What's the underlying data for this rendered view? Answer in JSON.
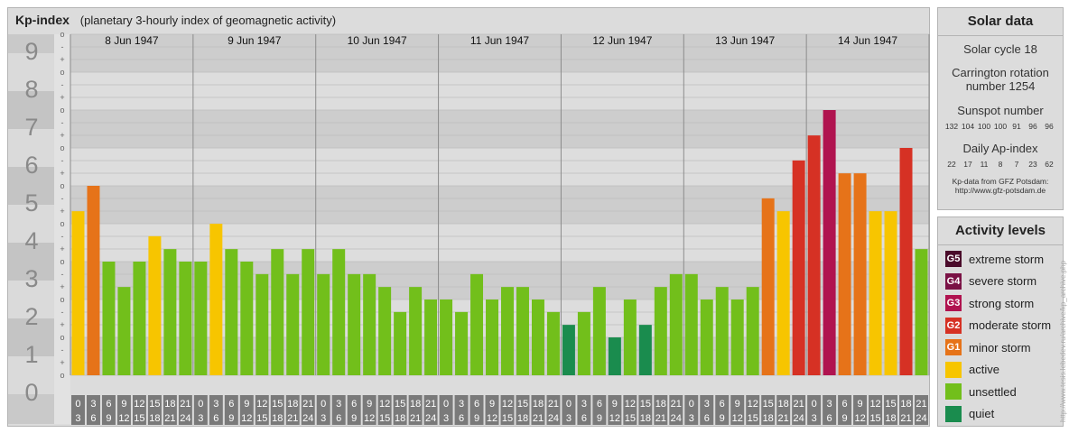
{
  "header": {
    "title": "Kp-index",
    "subtitle": "(planetary 3-hourly index of geomagnetic activity)"
  },
  "chart_data": {
    "type": "bar",
    "ylim": [
      0,
      9
    ],
    "y_ticks": [
      "0",
      "1",
      "2",
      "3",
      "4",
      "5",
      "6",
      "7",
      "8",
      "9"
    ],
    "third_marks": [
      "o",
      "+",
      "-"
    ],
    "days": [
      "8 Jun 1947",
      "9 Jun 1947",
      "10 Jun 1947",
      "11 Jun 1947",
      "12 Jun 1947",
      "13 Jun 1947",
      "14 Jun 1947"
    ],
    "interval_labels": [
      [
        "0",
        "3"
      ],
      [
        "3",
        "6"
      ],
      [
        "6",
        "9"
      ],
      [
        "9",
        "12"
      ],
      [
        "12",
        "15"
      ],
      [
        "15",
        "18"
      ],
      [
        "18",
        "21"
      ],
      [
        "21",
        "24"
      ]
    ],
    "values": [
      4.33,
      5.0,
      3.0,
      2.33,
      3.0,
      3.67,
      3.33,
      3.0,
      3.0,
      4.0,
      3.33,
      3.0,
      2.67,
      3.33,
      2.67,
      3.33,
      2.67,
      3.33,
      2.67,
      2.67,
      2.33,
      1.67,
      2.33,
      2.0,
      2.0,
      1.67,
      2.67,
      2.0,
      2.33,
      2.33,
      2.0,
      1.67,
      1.33,
      1.67,
      2.33,
      1.0,
      2.0,
      1.33,
      2.33,
      2.67,
      2.67,
      2.0,
      2.33,
      2.0,
      2.33,
      4.67,
      4.33,
      5.67,
      6.33,
      7.0,
      5.33,
      5.33,
      4.33,
      4.33,
      6.0,
      3.33
    ],
    "colors": {
      "quiet": "#1a8c4e",
      "unsettled": "#72bf1b",
      "active": "#f7c500",
      "G1": "#e67319",
      "G2": "#d63124",
      "G3": "#b0134f",
      "G4": "#7a1245",
      "G5": "#4a0b2a"
    }
  },
  "solar": {
    "title": "Solar data",
    "cycle": "Solar cycle 18",
    "carrington_1": "Carrington rotation",
    "carrington_2": "number 1254",
    "sunspot_label": "Sunspot number",
    "sunspots": [
      "132",
      "104",
      "100",
      "100",
      "91",
      "96",
      "96"
    ],
    "ap_label": "Daily Ap-index",
    "ap": [
      "22",
      "17",
      "11",
      "8",
      "7",
      "23",
      "62"
    ],
    "credit_1": "Kp-data from GFZ Potsdam:",
    "credit_2": "http://www.gfz-potsdam.de"
  },
  "activity": {
    "title": "Activity levels",
    "levels": [
      {
        "code": "G5",
        "label": "extreme storm",
        "color": "#4a0b2a"
      },
      {
        "code": "G4",
        "label": "severe storm",
        "color": "#7a1245"
      },
      {
        "code": "G3",
        "label": "strong storm",
        "color": "#b0134f"
      },
      {
        "code": "G2",
        "label": "moderate storm",
        "color": "#d63124"
      },
      {
        "code": "G1",
        "label": "minor storm",
        "color": "#e67319"
      },
      {
        "code": "",
        "label": "active",
        "color": "#f7c500"
      },
      {
        "code": "",
        "label": "unsettled",
        "color": "#72bf1b"
      },
      {
        "code": "",
        "label": "quiet",
        "color": "#1a8c4e"
      }
    ]
  },
  "side_credit": "http://www.tesis.lebedev.ru/archive/kp_archive.php"
}
